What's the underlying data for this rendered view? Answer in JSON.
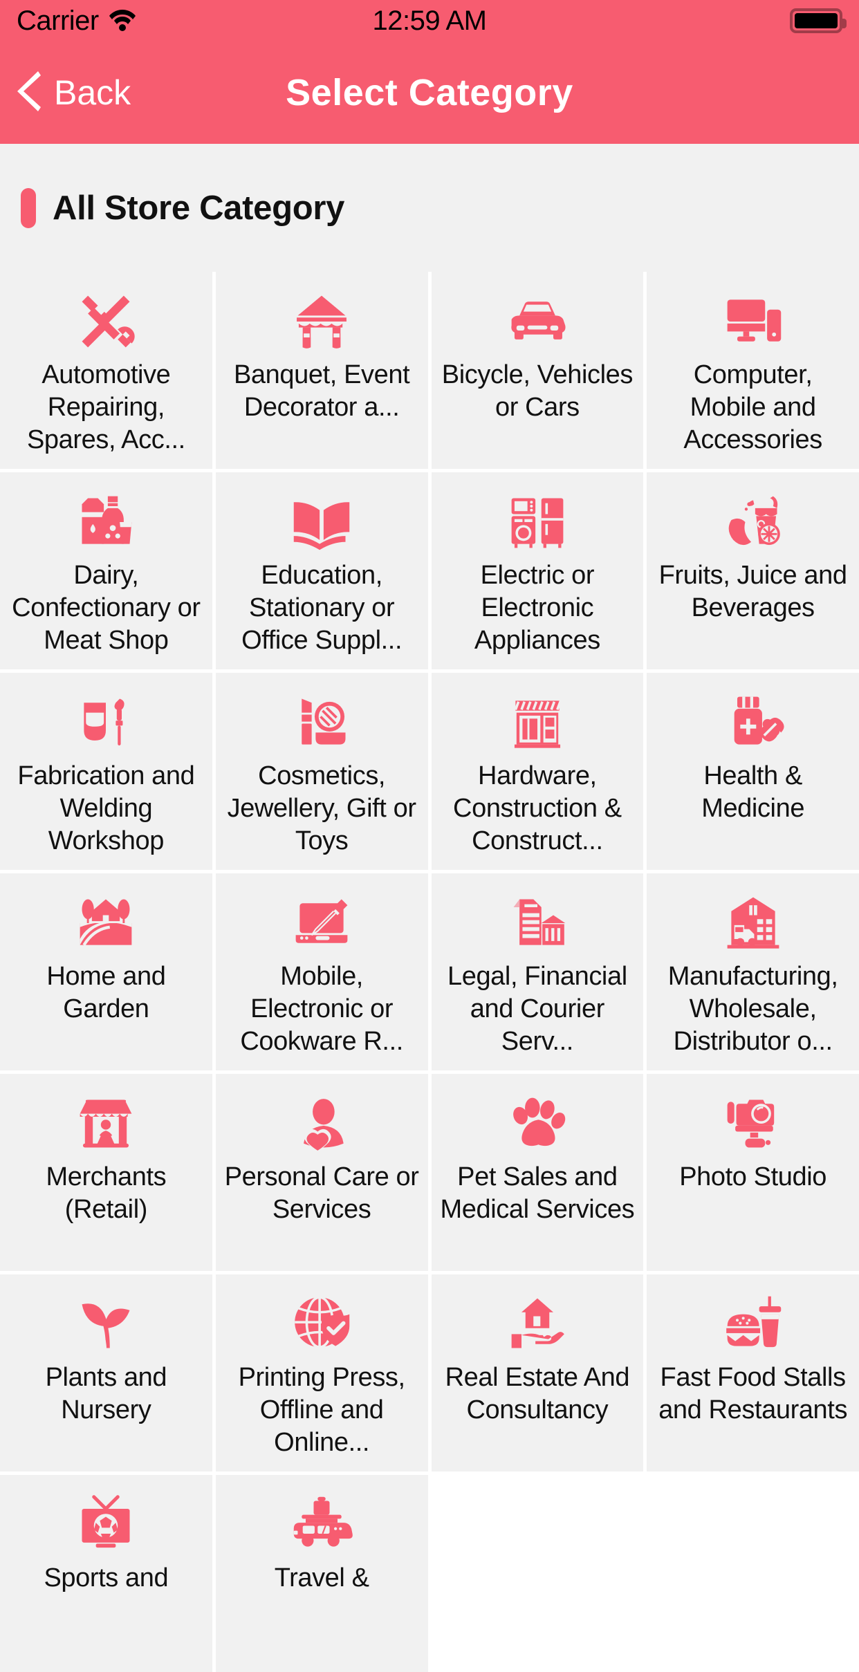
{
  "status_bar": {
    "carrier": "Carrier",
    "time": "12:59 AM",
    "wifi_icon": "wifi-icon",
    "battery_icon": "battery-full-icon"
  },
  "nav_bar": {
    "back_label": "Back",
    "back_icon": "chevron-left-icon",
    "title": "Select Category"
  },
  "section": {
    "title": "All Store Category",
    "accent_color": "#F75C70"
  },
  "theme": {
    "accent": "#F75C70",
    "header_bg": "#F75C70",
    "cell_bg": "#F1F1F1",
    "page_bg": "#FFFFFF",
    "text": "#111111"
  },
  "categories": [
    {
      "label": "Automotive Repairing, Spares, Acc...",
      "icon": "tools-hammer-wrench-icon"
    },
    {
      "label": "Banquet, Event Decorator a...",
      "icon": "tent-canopy-icon"
    },
    {
      "label": "Bicycle, Vehicles or Cars",
      "icon": "car-icon"
    },
    {
      "label": "Computer, Mobile and Accessories",
      "icon": "desktop-monitor-icon"
    },
    {
      "label": "Dairy, Confectionary or Meat Shop",
      "icon": "milk-carton-bottle-icon"
    },
    {
      "label": "Education, Stationary or Office Suppl...",
      "icon": "open-book-icon"
    },
    {
      "label": "Electric or Electronic Appliances",
      "icon": "home-appliances-icon"
    },
    {
      "label": "Fruits, Juice and Beverages",
      "icon": "juice-glass-fruit-icon"
    },
    {
      "label": "Fabrication and Welding Workshop",
      "icon": "welding-mask-torch-icon"
    },
    {
      "label": "Cosmetics, Jewellery, Gift or Toys",
      "icon": "lipstick-makeup-icon"
    },
    {
      "label": "Hardware, Construction & Construct...",
      "icon": "storefront-awning-icon"
    },
    {
      "label": "Health & Medicine",
      "icon": "medicine-bottle-pill-icon"
    },
    {
      "label": "Home and Garden",
      "icon": "house-garden-landscape-icon"
    },
    {
      "label": "Mobile, Electronic or Cookware R...",
      "icon": "laptop-screwdriver-repair-icon"
    },
    {
      "label": "Legal, Financial and Courier Serv...",
      "icon": "document-bank-building-icon"
    },
    {
      "label": "Manufacturing, Wholesale, Distributor o...",
      "icon": "warehouse-truck-icon"
    },
    {
      "label": "Merchants (Retail)",
      "icon": "shop-vendor-icon"
    },
    {
      "label": "Personal Care or Services",
      "icon": "person-heart-icon"
    },
    {
      "label": "Pet Sales and Medical Services",
      "icon": "paw-print-icon"
    },
    {
      "label": "Photo Studio",
      "icon": "camera-studio-icon"
    },
    {
      "label": "Plants and Nursery",
      "icon": "sprout-plant-icon"
    },
    {
      "label": "Printing Press, Offline and Online...",
      "icon": "globe-shield-icon"
    },
    {
      "label": "Real Estate And Consultancy",
      "icon": "house-in-hand-icon"
    },
    {
      "label": "Fast Food Stalls and Restaurants",
      "icon": "burger-drink-icon"
    },
    {
      "label": "Sports and",
      "icon": "tv-football-icon"
    },
    {
      "label": "Travel &",
      "icon": "safari-jeep-luggage-icon"
    }
  ]
}
